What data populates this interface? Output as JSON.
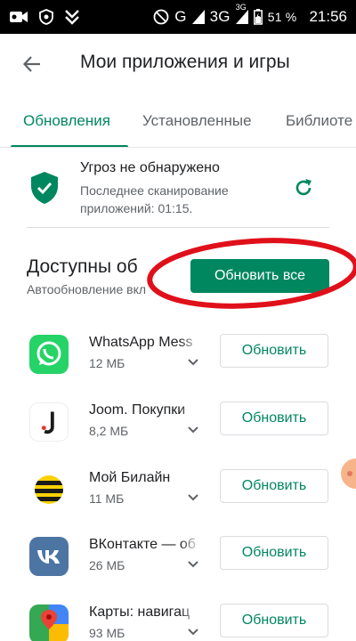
{
  "status_bar": {
    "icons": [
      "video-camera-icon",
      "vpn-shield-icon",
      "download-check-icon",
      "do-not-disturb-icon",
      "battery-icon"
    ],
    "network": "G",
    "network2": "3G",
    "network2_sup": "3G",
    "battery": "51 %",
    "time": "21:56"
  },
  "app_bar": {
    "back_icon": "arrow-back-icon",
    "title": "Мои приложения и игры"
  },
  "tabs": [
    {
      "label": "Обновления",
      "active": true
    },
    {
      "label": "Установленные",
      "active": false
    },
    {
      "label": "Библиоте",
      "active": false
    }
  ],
  "security": {
    "title": "Угроз не обнаружено",
    "subtitle": "Последнее сканирование приложений: 01:15.",
    "icon": "shield-check-icon",
    "refresh_icon": "refresh-icon"
  },
  "updates": {
    "title": "Доступны об",
    "subtitle": "Автообновление вкл",
    "update_all_label": "Обновить все",
    "accent": "#01875f",
    "highlight_color": "#e0101a"
  },
  "apps": [
    {
      "name": "WhatsApp Mess",
      "size": "12 МБ",
      "button": "Обновить",
      "icon": "whatsapp-icon"
    },
    {
      "name": "Joom. Покупки",
      "size": "8,2 МБ",
      "button": "Обновить",
      "icon": "joom-icon"
    },
    {
      "name": "Мой Билайн",
      "size": "11 МБ",
      "button": "Обновить",
      "icon": "beeline-icon"
    },
    {
      "name": "ВКонтакте — об",
      "size": "26 МБ",
      "button": "Обновить",
      "icon": "vk-icon"
    },
    {
      "name": "Карты: навигац",
      "size": "93 МБ",
      "button": "Обновить",
      "icon": "google-maps-icon"
    }
  ]
}
